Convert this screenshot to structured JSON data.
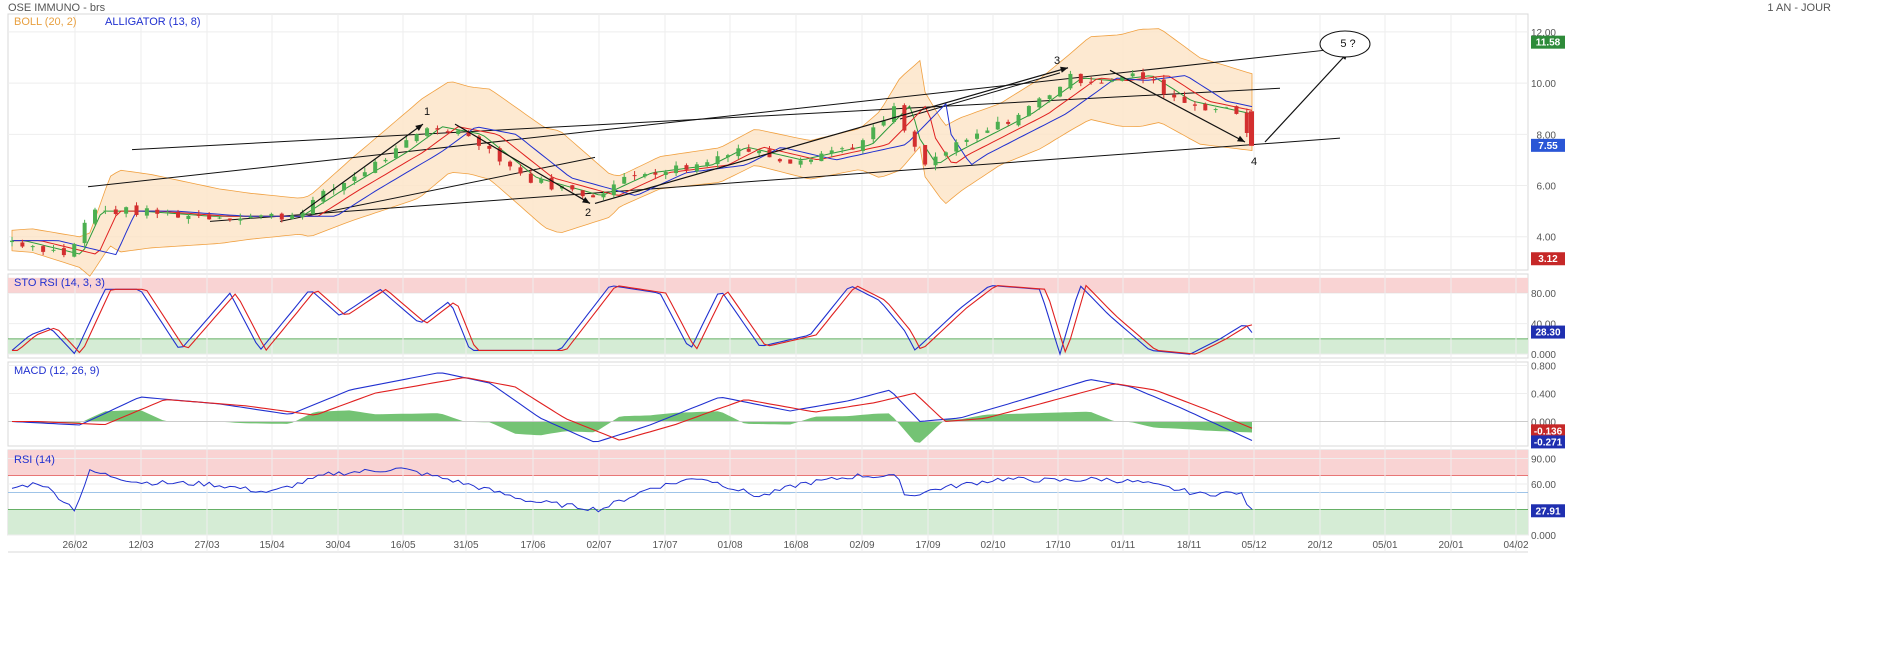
{
  "header": {
    "title": "OSE IMMUNO - brs",
    "period": "1 AN - JOUR"
  },
  "indicators": {
    "boll": "BOLL (20, 2)",
    "alligator": "ALLIGATOR (13, 8)",
    "stoch_rsi": "STO RSI (14, 3, 3)",
    "macd": "MACD (12, 26, 9)",
    "rsi": "RSI (14)"
  },
  "colors": {
    "up": "#4caf50",
    "down": "#d32f2f",
    "boll_fill": "#fde3c6",
    "boll_line": "#f0a040",
    "blue": "#2030d0",
    "red": "#e02020",
    "green": "#2a9a3a",
    "over_zone": "#f9d3d3",
    "under_zone": "#d5ecd5",
    "macd_hist": "#5cb85c"
  },
  "x_axis": {
    "labels": [
      "26/02",
      "12/03",
      "27/03",
      "15/04",
      "30/04",
      "16/05",
      "31/05",
      "17/06",
      "02/07",
      "17/07",
      "01/08",
      "16/08",
      "02/09",
      "17/09",
      "02/10",
      "17/10",
      "01/11",
      "18/11",
      "05/12",
      "20/12",
      "05/01",
      "20/01",
      "04/02"
    ]
  },
  "price_axis": {
    "ticks": [
      "12.00",
      "10.00",
      "8.00",
      "6.00",
      "4.00"
    ],
    "tick_values": [
      12,
      10,
      8,
      6,
      4
    ],
    "ylim": [
      2.7,
      12.7
    ]
  },
  "stoch_axis": {
    "ticks": [
      "80.00",
      "40.00",
      "0.000"
    ],
    "tick_values": [
      80,
      40,
      0
    ],
    "ylim": [
      -5,
      105
    ]
  },
  "macd_axis": {
    "ticks": [
      "0.800",
      "0.400",
      "0.000"
    ],
    "tick_values": [
      0.8,
      0.4,
      0.0
    ],
    "ylim": [
      -0.35,
      0.85
    ]
  },
  "rsi_axis": {
    "ticks": [
      "90.00",
      "60.00",
      "0.000"
    ],
    "tick_values": [
      90,
      60,
      0
    ],
    "ylim": [
      0,
      100
    ]
  },
  "badges": {
    "price_high": "11.58",
    "price_last": "7.55",
    "price_low": "3.12",
    "stoch": "28.30",
    "macd_a": "-0.136",
    "macd_b": "-0.271",
    "rsi": "27.91"
  },
  "wave_labels": {
    "w1": "1",
    "w2": "2",
    "w3": "3",
    "w4": "4",
    "w5": "5 ?"
  },
  "chart_data": {
    "type": "candlestick",
    "title": "OSE IMMUNO - brs",
    "x": [
      "26/02",
      "12/03",
      "27/03",
      "15/04",
      "30/04",
      "16/05",
      "31/05",
      "17/06",
      "02/07",
      "17/07",
      "01/08",
      "16/08",
      "02/09",
      "17/09",
      "02/10",
      "17/10",
      "01/11",
      "18/11",
      "05/12"
    ],
    "series": [
      {
        "name": "price_close",
        "values": [
          5.0,
          5.0,
          4.9,
          4.8,
          6.2,
          7.3,
          8.3,
          6.0,
          5.8,
          6.7,
          7.5,
          7.0,
          8.4,
          7.0,
          8.3,
          10.3,
          10.0,
          9.1,
          7.55
        ]
      },
      {
        "name": "STO RSI (14, 3, 3)",
        "values": [
          80,
          85,
          30,
          10,
          80,
          70,
          40,
          5,
          5,
          90,
          40,
          10,
          85,
          5,
          85,
          50,
          45,
          0,
          28.3
        ]
      },
      {
        "name": "MACD (12, 26, 9)",
        "values": [
          0.05,
          0.33,
          0.25,
          0.12,
          0.35,
          0.6,
          0.62,
          0.1,
          -0.22,
          -0.02,
          0.3,
          0.18,
          0.25,
          -0.05,
          0.25,
          0.55,
          0.5,
          0.05,
          -0.271
        ]
      },
      {
        "name": "RSI (14)",
        "values": [
          72,
          60,
          55,
          50,
          70,
          78,
          65,
          38,
          30,
          48,
          66,
          45,
          66,
          42,
          60,
          64,
          60,
          45,
          27.91
        ]
      }
    ],
    "ylim": [
      2.7,
      12.7
    ]
  }
}
